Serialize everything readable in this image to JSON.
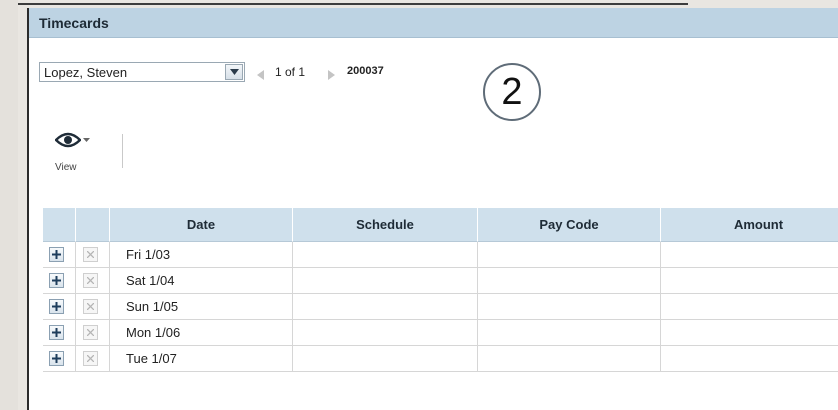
{
  "window": {
    "title": "Timecards"
  },
  "toolbar": {
    "employee": "Lopez, Steven",
    "pager": "1 of 1",
    "employee_id": "200037",
    "step_badge": "2",
    "view_label": "View"
  },
  "grid": {
    "columns": [
      "Date",
      "Schedule",
      "Pay Code",
      "Amount"
    ],
    "rows": [
      {
        "date": "Fri 1/03"
      },
      {
        "date": "Sat 1/04"
      },
      {
        "date": "Sun 1/05"
      },
      {
        "date": "Mon 1/06"
      },
      {
        "date": "Tue 1/07"
      }
    ]
  },
  "icons": {
    "add": "plus-icon",
    "delete": "x-icon",
    "view": "eye-icon",
    "dropdown": "chevron-down-icon",
    "prev": "triangle-left-icon",
    "next": "triangle-right-icon"
  }
}
